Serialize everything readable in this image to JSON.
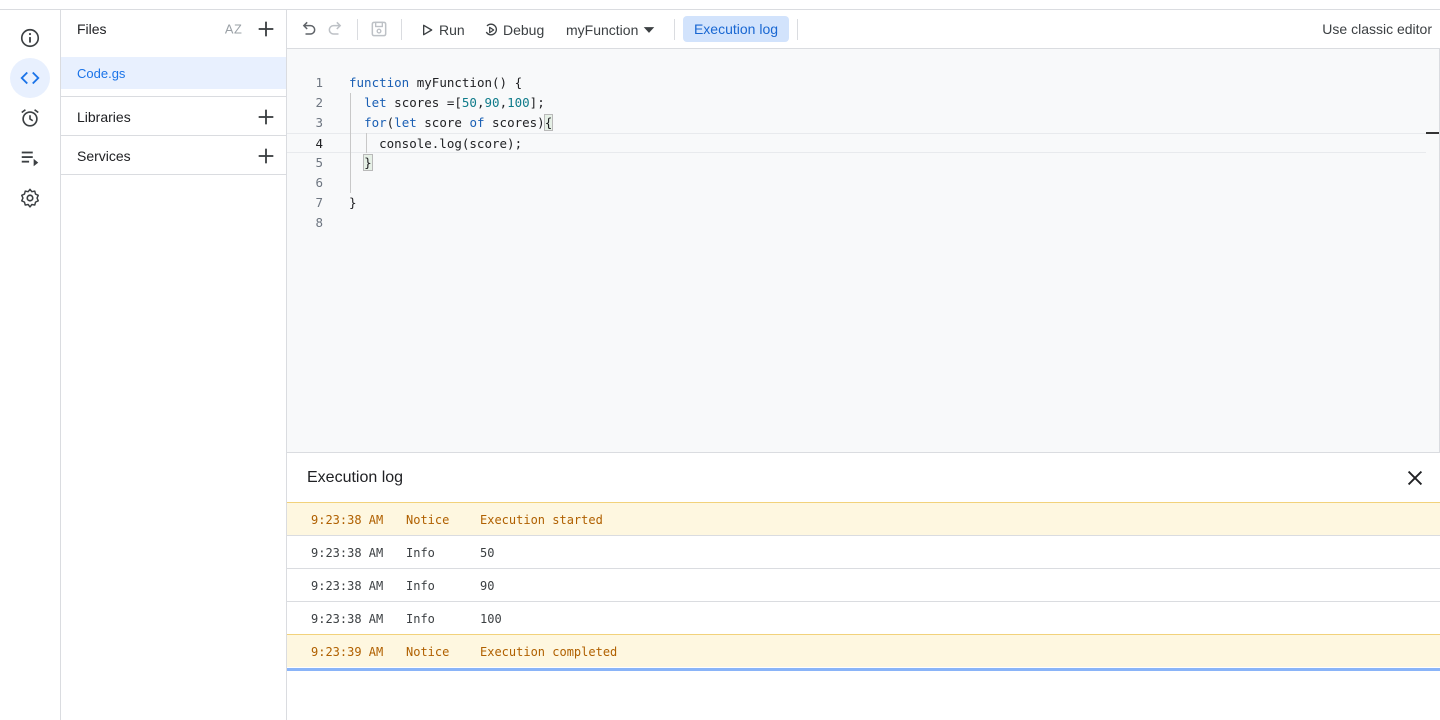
{
  "rail": {
    "icons": [
      "info-icon",
      "code-icon",
      "alarm-clock-icon",
      "executions-icon",
      "gear-icon"
    ]
  },
  "files_panel": {
    "title": "Files",
    "files": [
      {
        "name": "Code.gs"
      }
    ],
    "sections": [
      {
        "label": "Libraries"
      },
      {
        "label": "Services"
      }
    ]
  },
  "toolbar": {
    "run_label": "Run",
    "debug_label": "Debug",
    "function_select": "myFunction",
    "execution_log_label": "Execution log",
    "classic_editor_label": "Use classic editor"
  },
  "editor": {
    "current_line": 4,
    "lines": [
      {
        "n": "1",
        "text": "function myFunction() {"
      },
      {
        "n": "2",
        "text": "  let scores =[50,90,100];"
      },
      {
        "n": "3",
        "text": "  for(let score of scores){"
      },
      {
        "n": "4",
        "text": "    console.log(score);"
      },
      {
        "n": "5",
        "text": "  }"
      },
      {
        "n": "6",
        "text": ""
      },
      {
        "n": "7",
        "text": "}"
      },
      {
        "n": "8",
        "text": ""
      }
    ]
  },
  "execution_log": {
    "title": "Execution log",
    "rows": [
      {
        "time": "9:23:38 AM",
        "level": "Notice",
        "message": "Execution started"
      },
      {
        "time": "9:23:38 AM",
        "level": "Info",
        "message": "50"
      },
      {
        "time": "9:23:38 AM",
        "level": "Info",
        "message": "90"
      },
      {
        "time": "9:23:38 AM",
        "level": "Info",
        "message": "100"
      },
      {
        "time": "9:23:39 AM",
        "level": "Notice",
        "message": "Execution completed"
      }
    ]
  },
  "colors": {
    "accent": "#1a73e8",
    "active_bg": "#e8f0fe",
    "notice_bg": "#fef7e0",
    "notice_text": "#b06000"
  }
}
